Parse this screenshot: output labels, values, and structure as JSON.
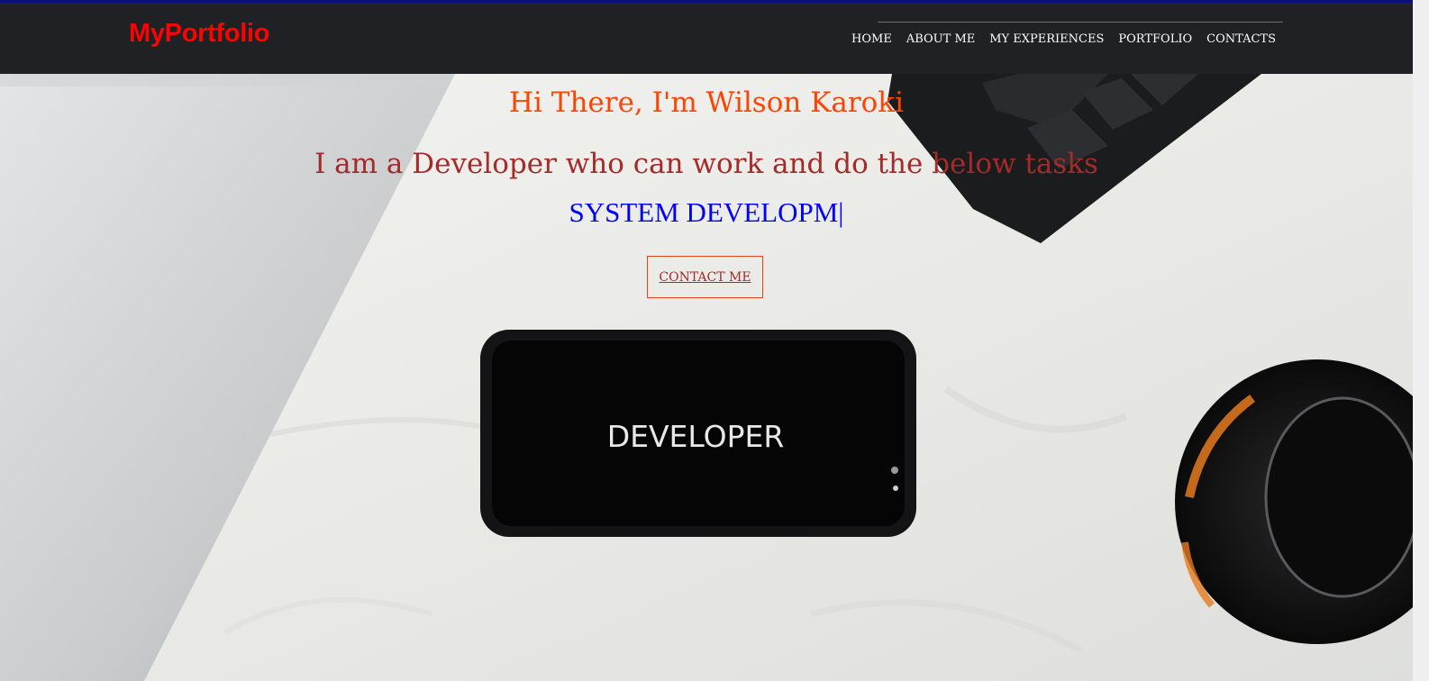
{
  "header": {
    "brand": "MyPortfolio",
    "nav": [
      {
        "label": "HOME"
      },
      {
        "label": "ABOUT ME"
      },
      {
        "label": "MY EXPERIENCES"
      },
      {
        "label": "PORTFOLIO"
      },
      {
        "label": "CONTACTS"
      }
    ]
  },
  "hero": {
    "greeting": "Hi There, I'm Wilson Karoki",
    "tagline": "I am a Developer who can work and do the below tasks",
    "typed_text": "SYSTEM DEVELOPM|",
    "cta_label": "CONTACT ME",
    "phone_screen_text": "DEVELOPER",
    "laptop_text": "ASUS"
  },
  "colors": {
    "brand": "#ff0000",
    "greeting": "#ff4500",
    "tagline": "#a52a2a",
    "typed": "#0000ff",
    "navbar_bg": "#1f2125"
  }
}
